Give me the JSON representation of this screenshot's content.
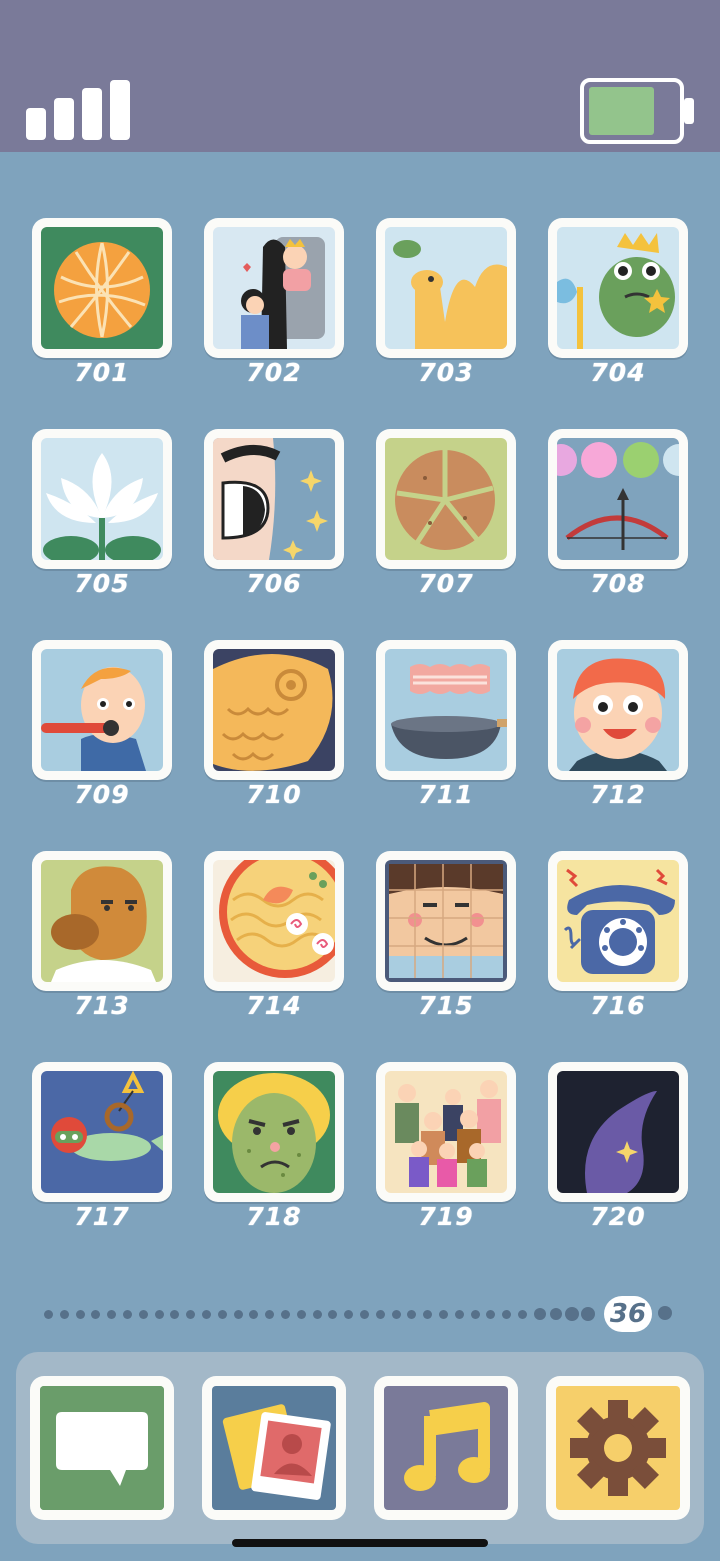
{
  "status": {
    "signal_bars": 4,
    "battery_level": 0.75,
    "battery_color": "#93c48c"
  },
  "levels": [
    {
      "number": "701",
      "icon": "orange-icon"
    },
    {
      "number": "702",
      "icon": "couple-icon"
    },
    {
      "number": "703",
      "icon": "camel-icon"
    },
    {
      "number": "704",
      "icon": "frog-king-icon"
    },
    {
      "number": "705",
      "icon": "lotus-icon"
    },
    {
      "number": "706",
      "icon": "eye-icon"
    },
    {
      "number": "707",
      "icon": "cookie-icon"
    },
    {
      "number": "708",
      "icon": "bow-balloons-icon"
    },
    {
      "number": "709",
      "icon": "boy-pipe-icon"
    },
    {
      "number": "710",
      "icon": "taiyaki-icon"
    },
    {
      "number": "711",
      "icon": "bacon-pan-icon"
    },
    {
      "number": "712",
      "icon": "redhead-icon"
    },
    {
      "number": "713",
      "icon": "bald-man-icon"
    },
    {
      "number": "714",
      "icon": "ramen-icon"
    },
    {
      "number": "715",
      "icon": "face-puzzle-icon"
    },
    {
      "number": "716",
      "icon": "rotary-phone-icon"
    },
    {
      "number": "717",
      "icon": "diver-icon"
    },
    {
      "number": "718",
      "icon": "green-face-icon"
    },
    {
      "number": "719",
      "icon": "family-icon"
    },
    {
      "number": "720",
      "icon": "purple-leaf-icon"
    }
  ],
  "pager": {
    "current_page": "36"
  },
  "dock": [
    {
      "name": "messages",
      "icon": "chat-bubble-icon",
      "color": "#6a9d6a"
    },
    {
      "name": "photos",
      "icon": "photos-icon",
      "color": "#5a7d9c"
    },
    {
      "name": "music",
      "icon": "music-note-icon",
      "color": "#7a7a99"
    },
    {
      "name": "settings",
      "icon": "gear-icon",
      "color": "#f6cf6a"
    }
  ]
}
